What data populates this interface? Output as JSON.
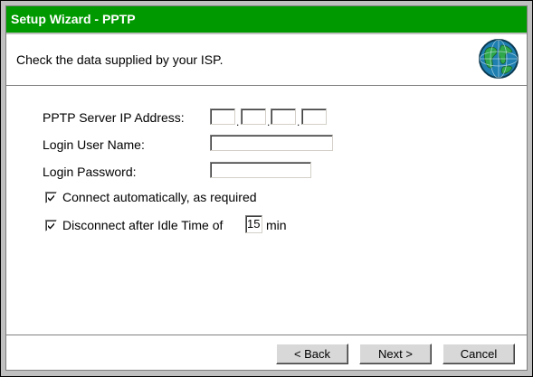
{
  "window": {
    "title": "Setup Wizard - PPTP"
  },
  "header": {
    "instruction": "Check the data supplied by your ISP.",
    "icon": "globe-icon"
  },
  "form": {
    "server_ip_label": "PPTP Server IP Address:",
    "server_ip_octets": [
      "",
      "",
      "",
      ""
    ],
    "ip_separator": ".",
    "login_user_label": "Login User Name:",
    "login_user_value": "",
    "login_password_label": "Login Password:",
    "login_password_value": "",
    "connect_auto_label": "Connect automatically, as required",
    "connect_auto_checked": true,
    "disconnect_idle_label": "Disconnect after Idle Time of",
    "disconnect_idle_checked": true,
    "idle_time_value": "15",
    "idle_time_unit": "min"
  },
  "buttons": {
    "back": "< Back",
    "next": "Next >",
    "cancel": "Cancel"
  },
  "colors": {
    "titlebar": "#009900",
    "title_text": "#ffffff",
    "background": "#ffffff"
  }
}
